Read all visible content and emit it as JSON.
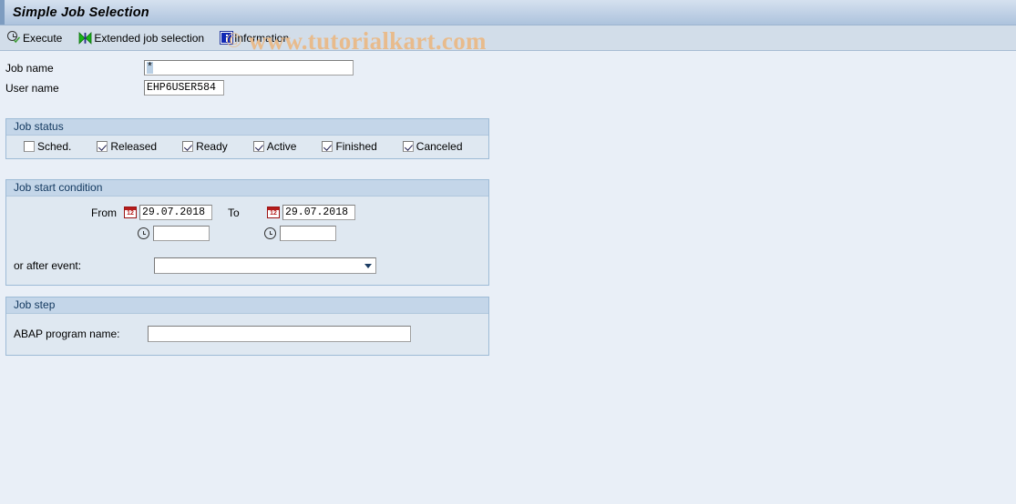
{
  "window": {
    "title": "Simple Job Selection"
  },
  "toolbar": {
    "buttons": [
      {
        "label": "Execute",
        "icon": "execute-clock-check-icon"
      },
      {
        "label": "Extended job selection",
        "icon": "extended-selection-bowtie-icon"
      },
      {
        "label": "Information",
        "icon": "information-icon"
      }
    ]
  },
  "watermark": {
    "copyright": "©",
    "text": "www.tutorialkart.com",
    "color": "#e8bb8c"
  },
  "form": {
    "job_name": {
      "label": "Job name",
      "value": "*",
      "placeholder": ""
    },
    "user_name": {
      "label": "User name",
      "value": "EHP6USER584",
      "placeholder": ""
    }
  },
  "job_status": {
    "title": "Job status",
    "options": [
      {
        "label": "Sched.",
        "checked": false
      },
      {
        "label": "Released",
        "checked": true
      },
      {
        "label": "Ready",
        "checked": true
      },
      {
        "label": "Active",
        "checked": true
      },
      {
        "label": "Finished",
        "checked": true
      },
      {
        "label": "Canceled",
        "checked": true
      }
    ]
  },
  "job_start_condition": {
    "title": "Job start condition",
    "from_label": "From",
    "to_label": "To",
    "from_date": "29.07.2018",
    "to_date": "29.07.2018",
    "from_time": "",
    "to_time": "",
    "calendar_day": "12",
    "event_label": "or after event:",
    "event_value": "",
    "event_options": []
  },
  "job_step": {
    "title": "Job step",
    "program_label": "ABAP program name:",
    "program_value": "",
    "program_placeholder": ""
  },
  "colors": {
    "background": "#e9eff7",
    "panel_header": "#c4d6e9",
    "panel_body": "#dfe8f1",
    "titlebar_accent": "#7d9cc0"
  }
}
